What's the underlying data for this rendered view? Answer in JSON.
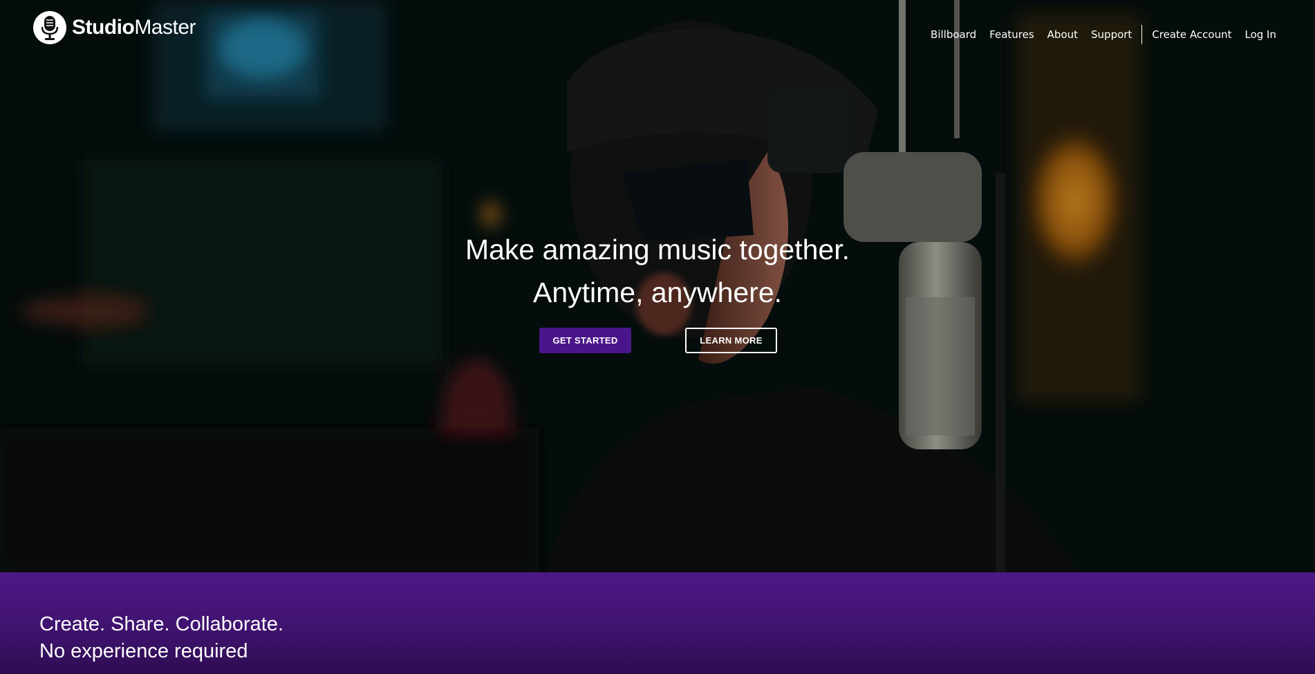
{
  "brand": {
    "name_bold": "Studio",
    "name_light": "Master",
    "icon": "microphone-icon"
  },
  "nav": {
    "items": [
      {
        "label": "Billboard"
      },
      {
        "label": "Features"
      },
      {
        "label": "About"
      },
      {
        "label": "Support"
      }
    ],
    "create_account": "Create Account",
    "log_in": "Log In"
  },
  "hero": {
    "line1": "Make amazing music together.",
    "line2": "Anytime, anywhere.",
    "primary_cta": "GET STARTED",
    "secondary_cta": "LEARN MORE"
  },
  "band": {
    "line1": "Create. Share. Collaborate.",
    "line2": "No experience required"
  },
  "colors": {
    "accent": "#4a158a",
    "band": "#4d1886",
    "text": "#ffffff"
  }
}
